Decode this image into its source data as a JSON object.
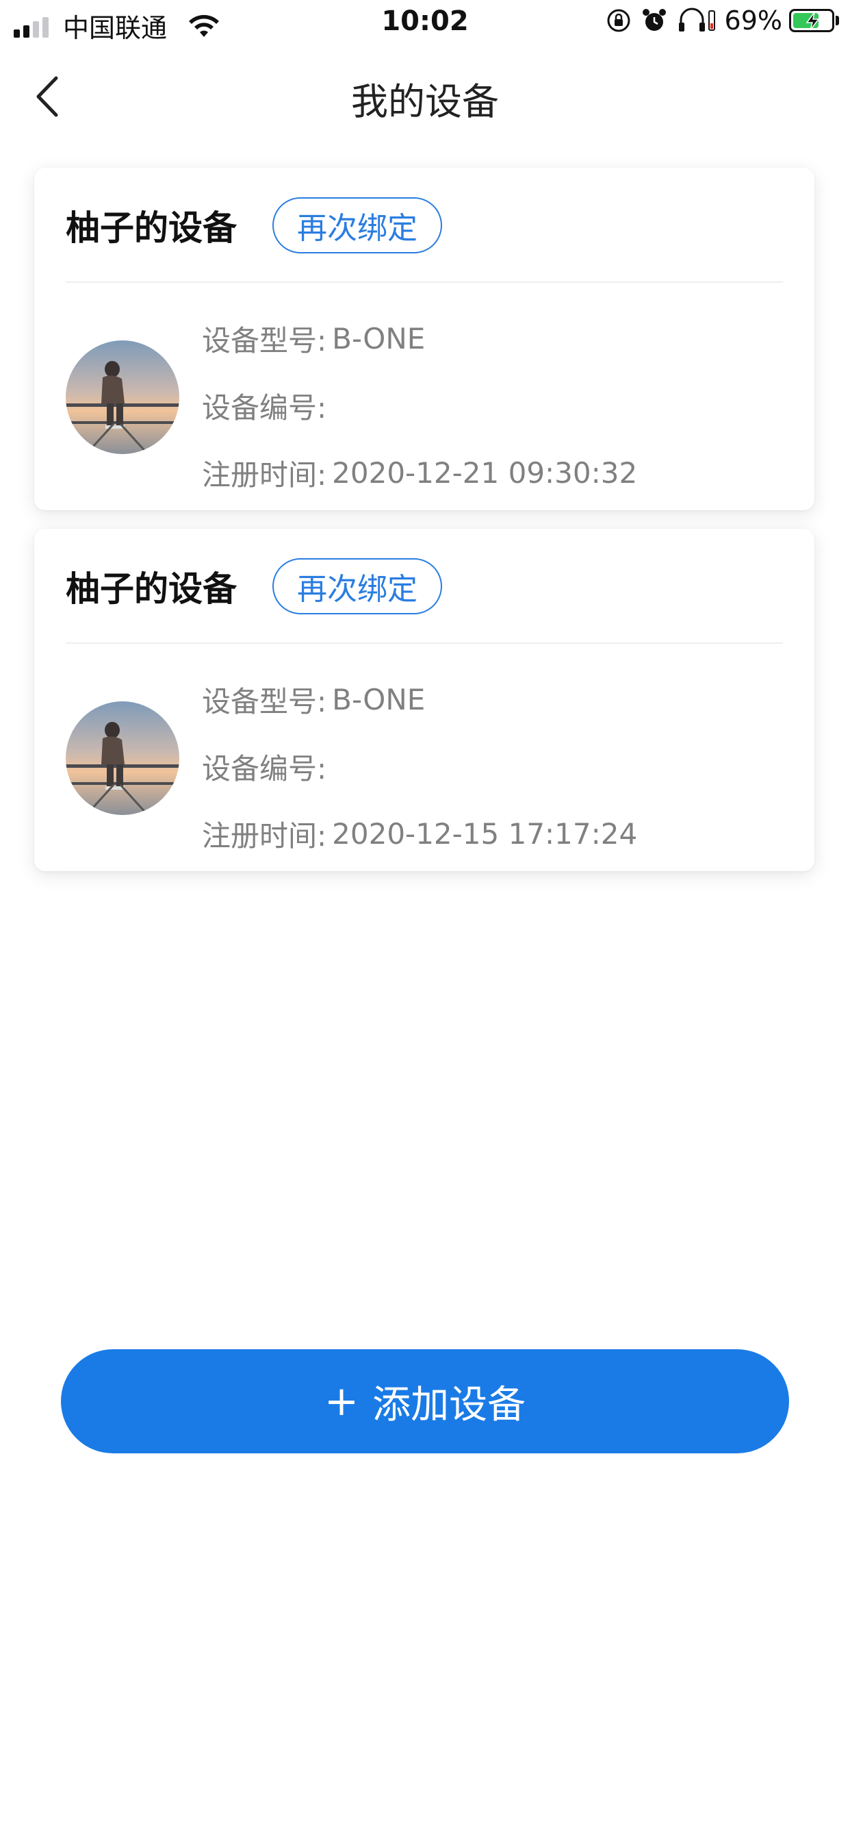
{
  "status_bar": {
    "carrier": "中国联通",
    "time": "10:02",
    "battery_percent": "69%",
    "battery_level": 0.69,
    "icons": [
      "signal-icon",
      "wifi-icon",
      "orientation-lock-icon",
      "alarm-icon",
      "headphones-icon",
      "battery-icon",
      "charging-bolt-icon"
    ]
  },
  "nav": {
    "title": "我的设备",
    "back_icon": "chevron-left-icon"
  },
  "devices": [
    {
      "name": "柚子的设备",
      "rebind_label": "再次绑定",
      "model_label": "设备型号:",
      "model_value": "B-ONE",
      "serial_label": "设备编号:",
      "serial_value": "",
      "registered_label": "注册时间:",
      "registered_value": "2020-12-21 09:30:32"
    },
    {
      "name": "柚子的设备",
      "rebind_label": "再次绑定",
      "model_label": "设备型号:",
      "model_value": "B-ONE",
      "serial_label": "设备编号:",
      "serial_value": "",
      "registered_label": "注册时间:",
      "registered_value": "2020-12-15 17:17:24"
    }
  ],
  "add_button": {
    "plus": "+",
    "label": "添加设备"
  },
  "colors": {
    "accent": "#1a7be6",
    "rebind_border": "#2a7de1",
    "info_text": "#808080"
  }
}
